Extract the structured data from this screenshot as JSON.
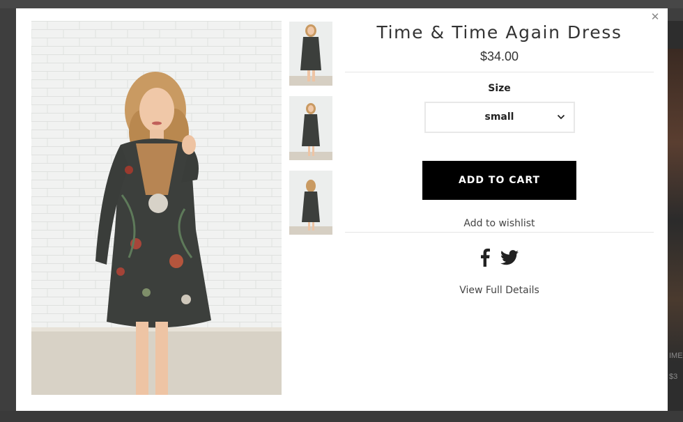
{
  "product": {
    "title": "Time & Time Again Dress",
    "price": "$34.00"
  },
  "options": {
    "size_label": "Size",
    "size_selected": "small"
  },
  "actions": {
    "add_to_cart": "ADD TO CART",
    "add_to_wishlist": "Add to wishlist",
    "view_details": "View Full Details"
  },
  "social": [
    "facebook-icon",
    "twitter-icon"
  ],
  "gallery": {
    "thumbnail_count": 3
  },
  "background": {
    "edge_texts": [
      "IME",
      "$3"
    ]
  },
  "colors": {
    "button_bg": "#000000",
    "button_text": "#ffffff",
    "overlay": "#3e3e3e"
  }
}
